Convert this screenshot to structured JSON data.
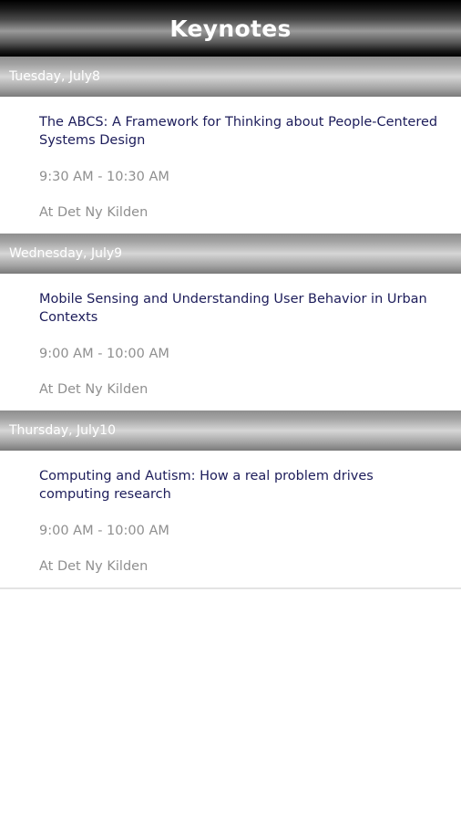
{
  "header": {
    "title": "Keynotes"
  },
  "days": [
    {
      "label": "Tuesday, July8",
      "talk": {
        "title": "The ABCS: A Framework for Thinking about People-Centered Systems Design",
        "time": "9:30 AM - 10:30 AM",
        "location": "At Det Ny Kilden"
      }
    },
    {
      "label": "Wednesday, July9",
      "talk": {
        "title": "Mobile Sensing and Understanding User Behavior in Urban Contexts",
        "time": "9:00 AM - 10:00 AM",
        "location": "At Det Ny Kilden"
      }
    },
    {
      "label": "Thursday, July10",
      "talk": {
        "title": "Computing and Autism: How a real problem drives computing research",
        "time": "9:00 AM - 10:00 AM",
        "location": "At Det Ny Kilden"
      }
    }
  ]
}
